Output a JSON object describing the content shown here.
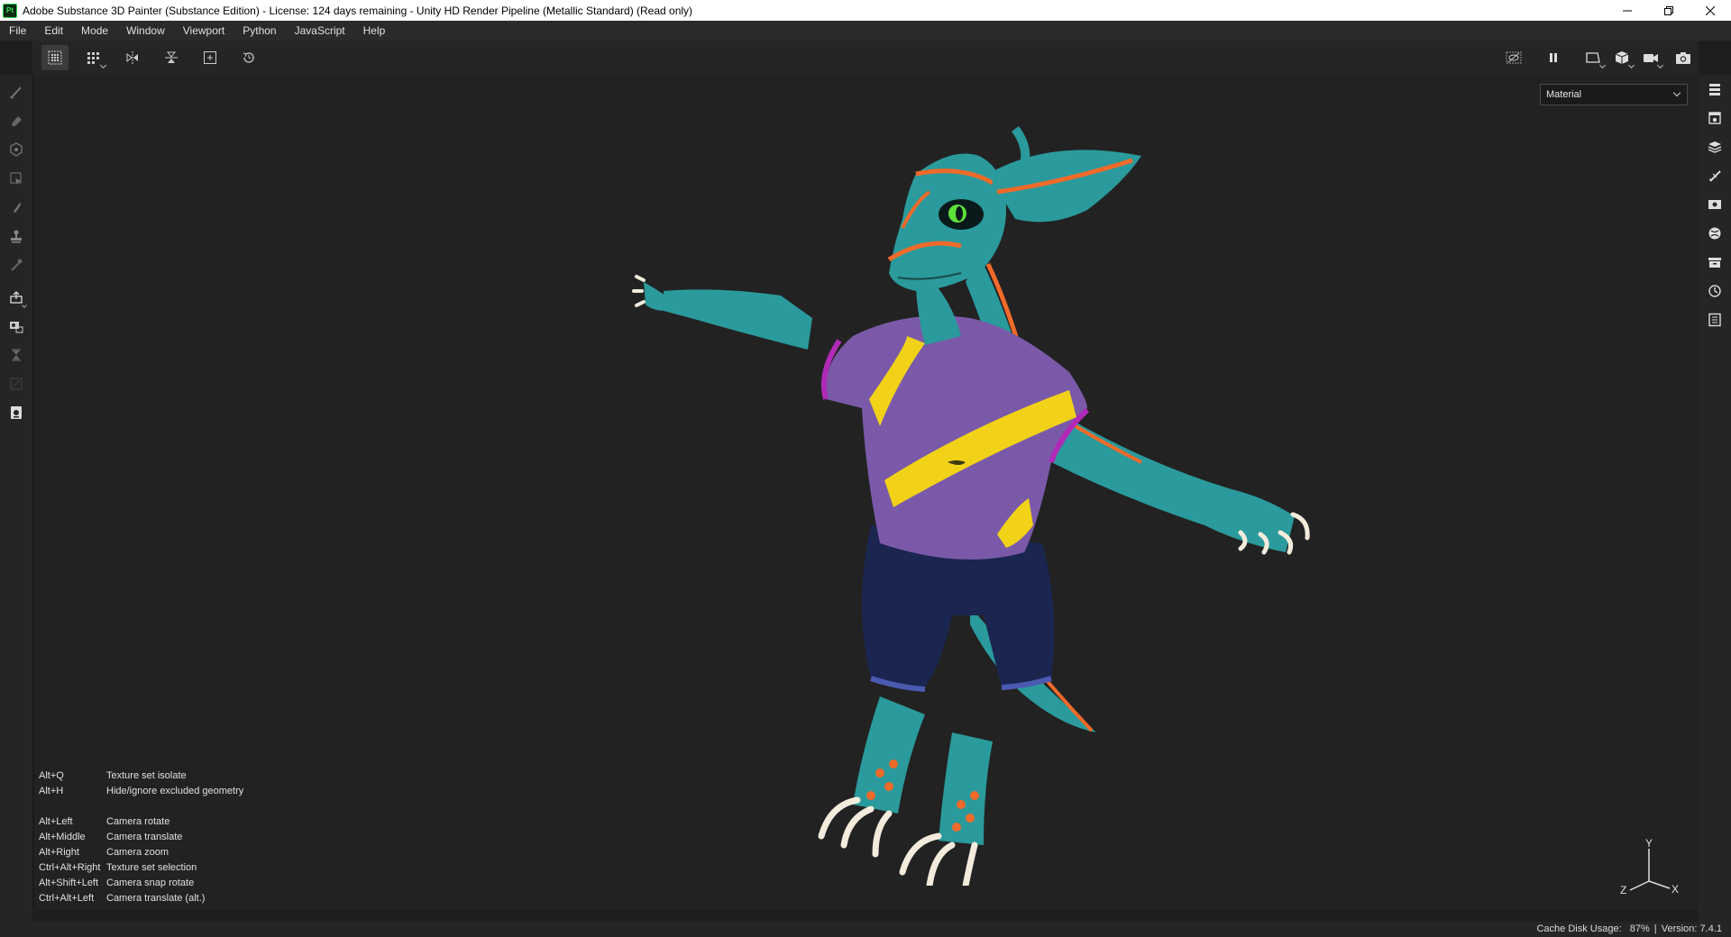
{
  "window": {
    "title": "Adobe Substance 3D Painter (Substance Edition) - License: 124 days remaining - Unity HD Render Pipeline (Metallic Standard) (Read only)",
    "logo_text": "Pt"
  },
  "menu": {
    "items": [
      "File",
      "Edit",
      "Mode",
      "Window",
      "Viewport",
      "Python",
      "JavaScript",
      "Help"
    ]
  },
  "viewport": {
    "channel_select": {
      "value": "Material"
    },
    "shortcuts": [
      {
        "key": "Alt+Q",
        "action": "Texture set isolate"
      },
      {
        "key": "Alt+H",
        "action": "Hide/ignore excluded geometry"
      },
      {
        "key": "Alt+Left",
        "action": "Camera rotate"
      },
      {
        "key": "Alt+Middle",
        "action": "Camera translate"
      },
      {
        "key": "Alt+Right",
        "action": "Camera zoom"
      },
      {
        "key": "Ctrl+Alt+Right",
        "action": "Texture set selection"
      },
      {
        "key": "Alt+Shift+Left",
        "action": "Camera snap rotate"
      },
      {
        "key": "Ctrl+Alt+Left",
        "action": "Camera translate (alt.)"
      }
    ],
    "gizmo": {
      "x": "X",
      "y": "Y",
      "z": "Z"
    }
  },
  "status": {
    "cache_label": "Cache Disk Usage:",
    "cache_value": "87%",
    "separator": "|",
    "version": "Version: 7.4.1"
  },
  "colors": {
    "background": "#222222",
    "panel": "#252525",
    "skin": "#2a9a9c",
    "accent_orange": "#f06a2a",
    "shirt": "#7a5aa8",
    "stripe": "#f2d218",
    "shorts": "#1a2550",
    "collar": "#b02ab8"
  }
}
